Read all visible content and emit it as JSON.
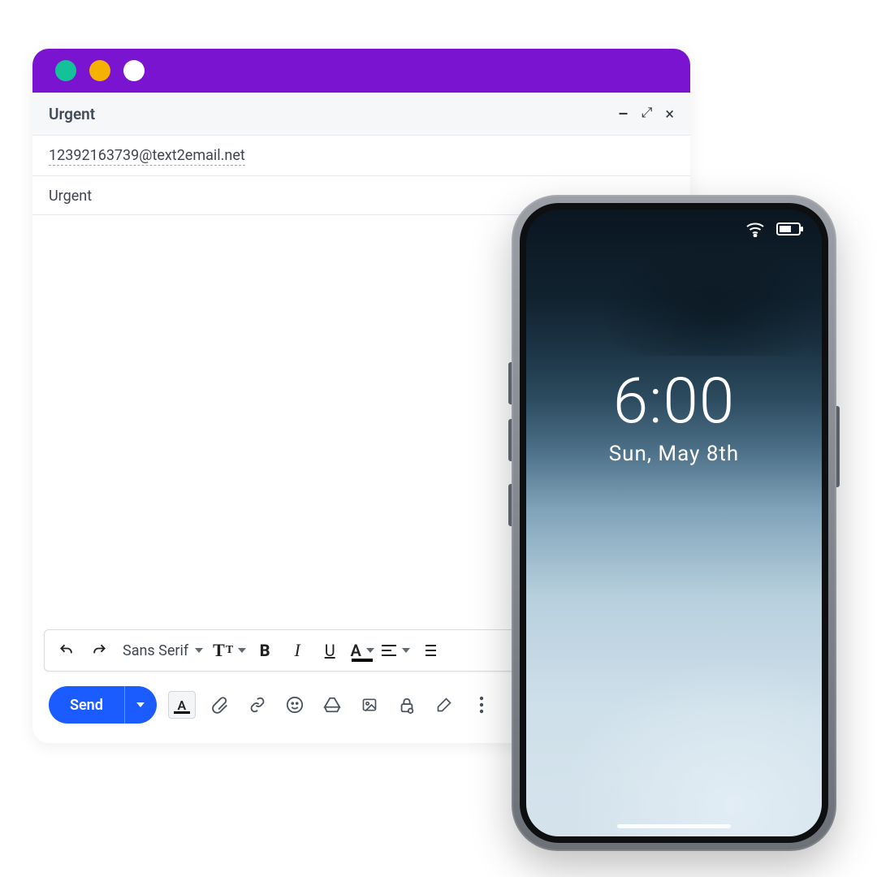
{
  "window": {
    "title": "Urgent",
    "dots": [
      "green",
      "yellow",
      "white"
    ]
  },
  "compose": {
    "recipient": "12392163739@text2email.net",
    "subject": "Urgent",
    "body": ""
  },
  "format_bar": {
    "font": "Sans Serif"
  },
  "actions": {
    "send": "Send"
  },
  "phone": {
    "time": "6:00",
    "date": "Sun, May 8th"
  }
}
